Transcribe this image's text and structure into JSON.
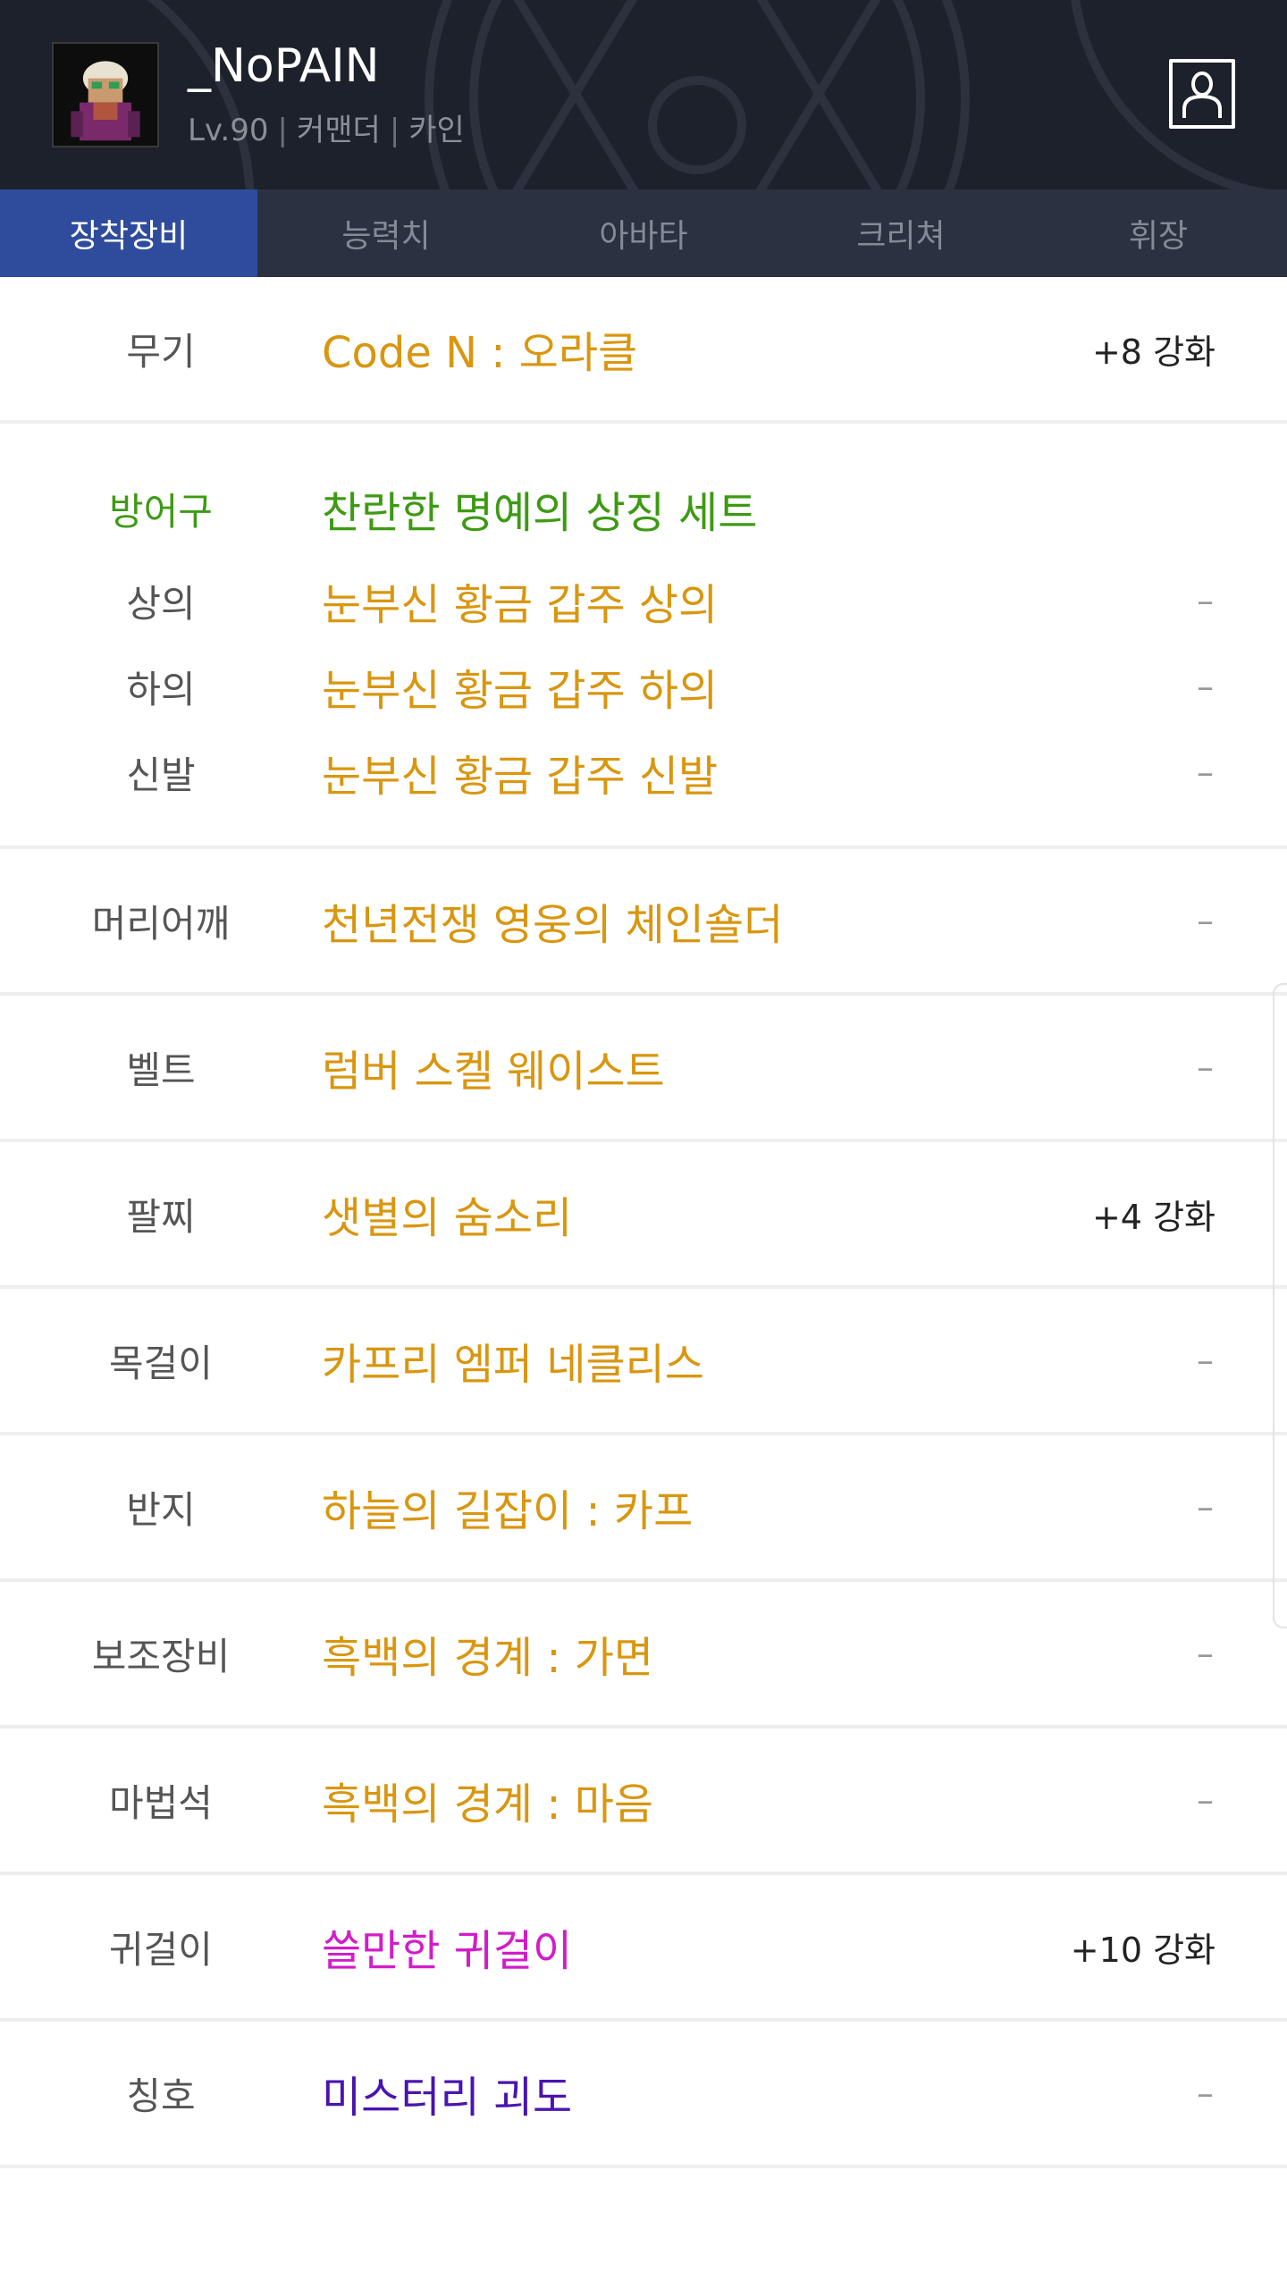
{
  "profile": {
    "name": "_NoPAIN",
    "level": "Lv.90",
    "job": "커맨더",
    "class": "카인"
  },
  "tabs": [
    {
      "label": "장착장비",
      "active": true
    },
    {
      "label": "능력치",
      "active": false
    },
    {
      "label": "아바타",
      "active": false
    },
    {
      "label": "크리쳐",
      "active": false
    },
    {
      "label": "휘장",
      "active": false
    }
  ],
  "equipment": {
    "weapon": {
      "slot": "무기",
      "name": "Code N : 오라클",
      "enhance": "+8 강화"
    },
    "armor_set": {
      "slot": "방어구",
      "name": "찬란한 명예의 상징 세트"
    },
    "top": {
      "slot": "상의",
      "name": "눈부신 황금 갑주 상의",
      "enhance": "–"
    },
    "bottom": {
      "slot": "하의",
      "name": "눈부신 황금 갑주 하의",
      "enhance": "–"
    },
    "shoes": {
      "slot": "신발",
      "name": "눈부신 황금 갑주 신발",
      "enhance": "–"
    },
    "shoulder": {
      "slot": "머리어깨",
      "name": "천년전쟁 영웅의 체인숄더",
      "enhance": "–"
    },
    "belt": {
      "slot": "벨트",
      "name": "럼버 스켈 웨이스트",
      "enhance": "–"
    },
    "bracelet": {
      "slot": "팔찌",
      "name": "샛별의 숨소리",
      "enhance": "+4 강화"
    },
    "necklace": {
      "slot": "목걸이",
      "name": "카프리 엠퍼 네클리스",
      "enhance": "–"
    },
    "ring": {
      "slot": "반지",
      "name": "하늘의 길잡이 : 카프",
      "enhance": "–"
    },
    "sub": {
      "slot": "보조장비",
      "name": "흑백의 경계 : 가면",
      "enhance": "–"
    },
    "magic_stone": {
      "slot": "마법석",
      "name": "흑백의 경계 : 마음",
      "enhance": "–"
    },
    "earring": {
      "slot": "귀걸이",
      "name": "쓸만한 귀걸이",
      "enhance": "+10 강화"
    },
    "title": {
      "slot": "칭호",
      "name": "미스터리 괴도",
      "enhance": "–"
    }
  },
  "colors": {
    "header_bg": "#1d212b",
    "tab_bar_bg": "#2b3140",
    "tab_active_bg": "#2f4c9c",
    "item_gold": "#d9960f",
    "set_green": "#3d9a13",
    "item_magenta": "#d21cc9",
    "item_purple": "#4a14b0"
  },
  "icons": {
    "profile": "person-icon",
    "avatar": "character-portrait"
  }
}
